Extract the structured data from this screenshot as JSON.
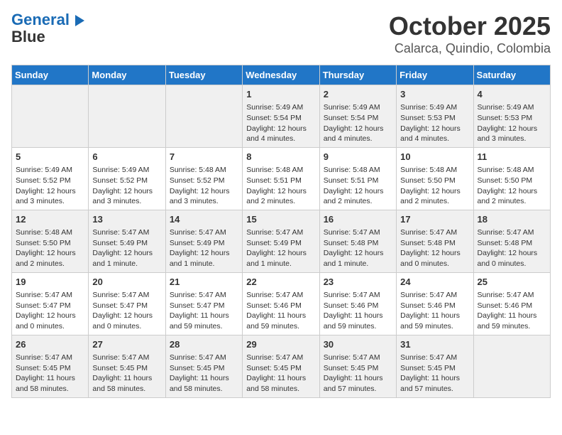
{
  "logo": {
    "line1": "General",
    "line2": "Blue"
  },
  "title": "October 2025",
  "subtitle": "Calarca, Quindio, Colombia",
  "weekdays": [
    "Sunday",
    "Monday",
    "Tuesday",
    "Wednesday",
    "Thursday",
    "Friday",
    "Saturday"
  ],
  "weeks": [
    [
      {
        "day": "",
        "info": ""
      },
      {
        "day": "",
        "info": ""
      },
      {
        "day": "",
        "info": ""
      },
      {
        "day": "1",
        "info": "Sunrise: 5:49 AM\nSunset: 5:54 PM\nDaylight: 12 hours\nand 4 minutes."
      },
      {
        "day": "2",
        "info": "Sunrise: 5:49 AM\nSunset: 5:54 PM\nDaylight: 12 hours\nand 4 minutes."
      },
      {
        "day": "3",
        "info": "Sunrise: 5:49 AM\nSunset: 5:53 PM\nDaylight: 12 hours\nand 4 minutes."
      },
      {
        "day": "4",
        "info": "Sunrise: 5:49 AM\nSunset: 5:53 PM\nDaylight: 12 hours\nand 3 minutes."
      }
    ],
    [
      {
        "day": "5",
        "info": "Sunrise: 5:49 AM\nSunset: 5:52 PM\nDaylight: 12 hours\nand 3 minutes."
      },
      {
        "day": "6",
        "info": "Sunrise: 5:49 AM\nSunset: 5:52 PM\nDaylight: 12 hours\nand 3 minutes."
      },
      {
        "day": "7",
        "info": "Sunrise: 5:48 AM\nSunset: 5:52 PM\nDaylight: 12 hours\nand 3 minutes."
      },
      {
        "day": "8",
        "info": "Sunrise: 5:48 AM\nSunset: 5:51 PM\nDaylight: 12 hours\nand 2 minutes."
      },
      {
        "day": "9",
        "info": "Sunrise: 5:48 AM\nSunset: 5:51 PM\nDaylight: 12 hours\nand 2 minutes."
      },
      {
        "day": "10",
        "info": "Sunrise: 5:48 AM\nSunset: 5:50 PM\nDaylight: 12 hours\nand 2 minutes."
      },
      {
        "day": "11",
        "info": "Sunrise: 5:48 AM\nSunset: 5:50 PM\nDaylight: 12 hours\nand 2 minutes."
      }
    ],
    [
      {
        "day": "12",
        "info": "Sunrise: 5:48 AM\nSunset: 5:50 PM\nDaylight: 12 hours\nand 2 minutes."
      },
      {
        "day": "13",
        "info": "Sunrise: 5:47 AM\nSunset: 5:49 PM\nDaylight: 12 hours\nand 1 minute."
      },
      {
        "day": "14",
        "info": "Sunrise: 5:47 AM\nSunset: 5:49 PM\nDaylight: 12 hours\nand 1 minute."
      },
      {
        "day": "15",
        "info": "Sunrise: 5:47 AM\nSunset: 5:49 PM\nDaylight: 12 hours\nand 1 minute."
      },
      {
        "day": "16",
        "info": "Sunrise: 5:47 AM\nSunset: 5:48 PM\nDaylight: 12 hours\nand 1 minute."
      },
      {
        "day": "17",
        "info": "Sunrise: 5:47 AM\nSunset: 5:48 PM\nDaylight: 12 hours\nand 0 minutes."
      },
      {
        "day": "18",
        "info": "Sunrise: 5:47 AM\nSunset: 5:48 PM\nDaylight: 12 hours\nand 0 minutes."
      }
    ],
    [
      {
        "day": "19",
        "info": "Sunrise: 5:47 AM\nSunset: 5:47 PM\nDaylight: 12 hours\nand 0 minutes."
      },
      {
        "day": "20",
        "info": "Sunrise: 5:47 AM\nSunset: 5:47 PM\nDaylight: 12 hours\nand 0 minutes."
      },
      {
        "day": "21",
        "info": "Sunrise: 5:47 AM\nSunset: 5:47 PM\nDaylight: 11 hours\nand 59 minutes."
      },
      {
        "day": "22",
        "info": "Sunrise: 5:47 AM\nSunset: 5:46 PM\nDaylight: 11 hours\nand 59 minutes."
      },
      {
        "day": "23",
        "info": "Sunrise: 5:47 AM\nSunset: 5:46 PM\nDaylight: 11 hours\nand 59 minutes."
      },
      {
        "day": "24",
        "info": "Sunrise: 5:47 AM\nSunset: 5:46 PM\nDaylight: 11 hours\nand 59 minutes."
      },
      {
        "day": "25",
        "info": "Sunrise: 5:47 AM\nSunset: 5:46 PM\nDaylight: 11 hours\nand 59 minutes."
      }
    ],
    [
      {
        "day": "26",
        "info": "Sunrise: 5:47 AM\nSunset: 5:45 PM\nDaylight: 11 hours\nand 58 minutes."
      },
      {
        "day": "27",
        "info": "Sunrise: 5:47 AM\nSunset: 5:45 PM\nDaylight: 11 hours\nand 58 minutes."
      },
      {
        "day": "28",
        "info": "Sunrise: 5:47 AM\nSunset: 5:45 PM\nDaylight: 11 hours\nand 58 minutes."
      },
      {
        "day": "29",
        "info": "Sunrise: 5:47 AM\nSunset: 5:45 PM\nDaylight: 11 hours\nand 58 minutes."
      },
      {
        "day": "30",
        "info": "Sunrise: 5:47 AM\nSunset: 5:45 PM\nDaylight: 11 hours\nand 57 minutes."
      },
      {
        "day": "31",
        "info": "Sunrise: 5:47 AM\nSunset: 5:45 PM\nDaylight: 11 hours\nand 57 minutes."
      },
      {
        "day": "",
        "info": ""
      }
    ]
  ]
}
